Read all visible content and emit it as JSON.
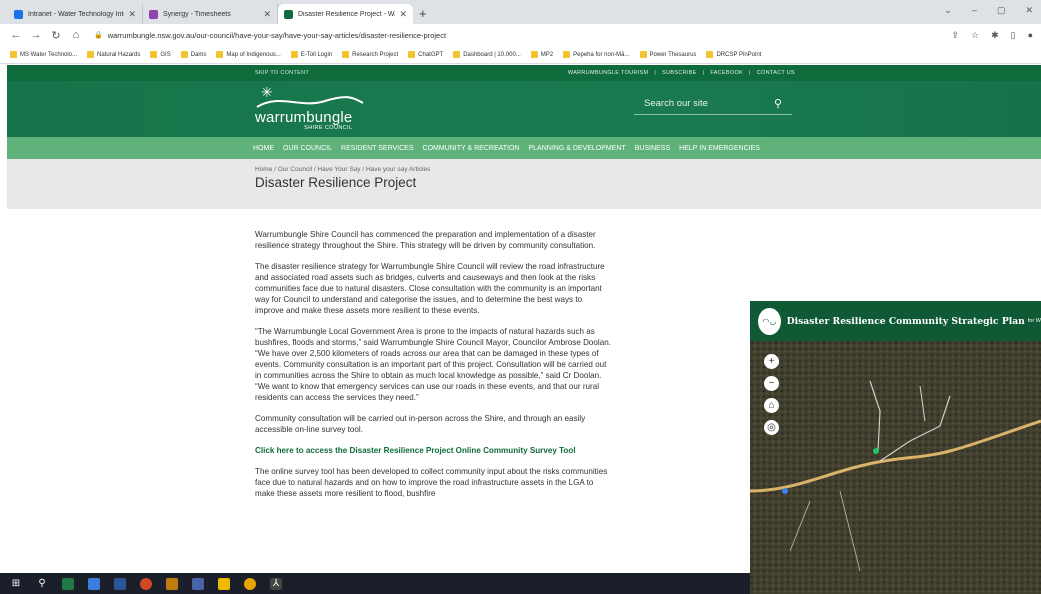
{
  "browser": {
    "tabs": [
      {
        "title": "Intranet - Water Technology Inte",
        "color": "#1a73e8"
      },
      {
        "title": "Synergy - Timesheets",
        "color": "#8e44ad"
      },
      {
        "title": "Disaster Resilience Project - Wa",
        "color": "#0f6b3c"
      }
    ],
    "new_tab": "+",
    "url": "warrumbungle.nsw.gov.au/our-council/have-your-say/have-your-say-articles/disaster-resilience-project",
    "bookmarks": [
      "MS Water Technolo...",
      "Natural Hazards",
      "GIS",
      "Dams",
      "Map of Indigenous...",
      "E-Toll Login",
      "Research Project",
      "ChatGPT",
      "Dashboard | 10.000...",
      "MP2",
      "Pepeha for non-Mā...",
      "Power Thesaurus",
      "DRCSP PinPoint"
    ]
  },
  "site": {
    "skip": "SKIP TO CONTENT",
    "toplinks": [
      "WARRUMBUNGLE TOURISM",
      "SUBSCRIBE",
      "FACEBOOK",
      "CONTACT US"
    ],
    "logo_name": "warrumbungle",
    "logo_sub": "SHIRE COUNCIL",
    "search_placeholder": "Search our site",
    "menu": [
      "HOME",
      "OUR COUNCIL",
      "RESIDENT SERVICES",
      "COMMUNITY & RECREATION",
      "PLANNING & DEVELOPMENT",
      "BUSINESS",
      "HELP IN EMERGENCIES"
    ],
    "breadcrumbs": [
      "Home",
      "Our Council",
      "Have Your Say",
      "Have your say Articles"
    ],
    "page_title": "Disaster Resilience Project",
    "paragraphs": [
      "Warrumbungle Shire Council has commenced the preparation and implementation of a disaster resilience strategy throughout the Shire. This strategy will be driven by community consultation.",
      "The disaster resilience strategy for Warrumbungle Shire Council will review the road infrastructure and associated road assets such as bridges, culverts and causeways and then look at the risks communities face due to natural disasters. Close consultation with the community is an important way for Council to understand and categorise the issues, and to determine the best ways to improve and make these assets more resilient to these events.",
      "“The Warrumbungle Local Government Area is prone to the impacts of natural hazards such as bushfires, floods and storms,” said Warrumbungle Shire Council Mayor, Councilor Ambrose Doolan. “We have over 2,500 kilometers of roads across our area that can be damaged in these types of events. Community consultation is an important part of this project. Consultation will be carried out in communities across the Shire to obtain as much local knowledge as possible,” said Cr Doolan. “We want to know that emergency services can use our roads in these events, and that our rural residents can access the services they need.”",
      "Community consultation will be carried out in-person across the Shire, and through an easily accessible on-line survey tool."
    ],
    "survey_link": "Click here to access the Disaster Resilience Project Online Community Survey Tool",
    "last_paragraph": "The online survey tool has been developed to collect community input about the risks communities face due to natural hazards and on how to improve the road infrastructure assets in the LGA to make these assets more resilient to flood, bushfire"
  },
  "map": {
    "title": "Disaster Resilience Community Strategic Plan",
    "subtitle": "for W",
    "controls": [
      "+",
      "−",
      "⌂",
      "◎"
    ]
  },
  "colors": {
    "brand_dark": "#0f6b3c",
    "brand_light": "#5fb27a"
  }
}
